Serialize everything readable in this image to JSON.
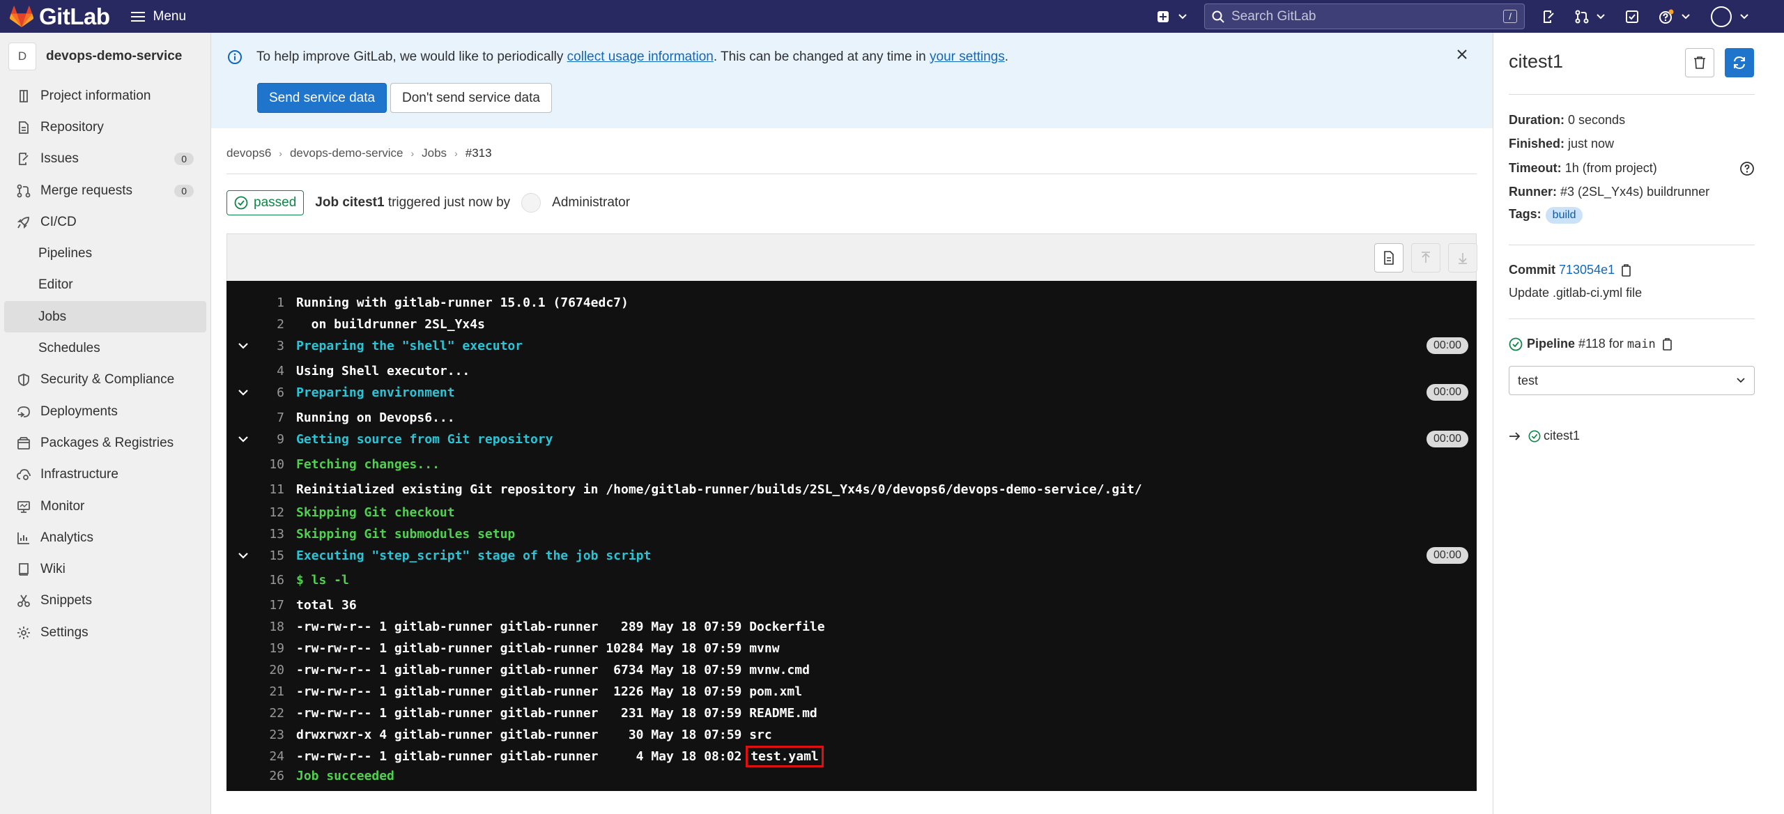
{
  "topbar": {
    "logo_text": "GitLab",
    "menu_label": "Menu",
    "search_placeholder": "Search GitLab",
    "search_shortcut": "/"
  },
  "sidebar": {
    "project_initial": "D",
    "project_name": "devops-demo-service",
    "items": [
      {
        "label": "Project information",
        "icon": "info-outline-icon"
      },
      {
        "label": "Repository",
        "icon": "doc-text-icon"
      },
      {
        "label": "Issues",
        "icon": "issues-icon",
        "count": "0"
      },
      {
        "label": "Merge requests",
        "icon": "merge-request-icon",
        "count": "0"
      },
      {
        "label": "CI/CD",
        "icon": "rocket-icon"
      },
      {
        "label": "Pipelines"
      },
      {
        "label": "Editor"
      },
      {
        "label": "Jobs"
      },
      {
        "label": "Schedules"
      },
      {
        "label": "Security & Compliance",
        "icon": "shield-icon"
      },
      {
        "label": "Deployments",
        "icon": "deployments-icon"
      },
      {
        "label": "Packages & Registries",
        "icon": "package-icon"
      },
      {
        "label": "Infrastructure",
        "icon": "cloud-gear-icon"
      },
      {
        "label": "Monitor",
        "icon": "monitor-icon"
      },
      {
        "label": "Analytics",
        "icon": "chart-icon"
      },
      {
        "label": "Wiki",
        "icon": "book-icon"
      },
      {
        "label": "Snippets",
        "icon": "snippet-icon"
      },
      {
        "label": "Settings",
        "icon": "settings-icon"
      }
    ]
  },
  "banner": {
    "text_before": "To help improve GitLab, we would like to periodically ",
    "link1": "collect usage information",
    "text_middle": ". This can be changed at any time in ",
    "link2": "your settings",
    "text_after": ".",
    "send_button": "Send service data",
    "dont_send_button": "Don't send service data"
  },
  "breadcrumb": [
    "devops6",
    "devops-demo-service",
    "Jobs",
    "#313"
  ],
  "job_header": {
    "status": "passed",
    "job_label": "Job citest1",
    "triggered_text": "triggered just now by",
    "user": "Administrator"
  },
  "log": [
    {
      "n": "1",
      "text": "Running with gitlab-runner 15.0.1 (7674edc7)",
      "style": "white"
    },
    {
      "n": "2",
      "text": "  on buildrunner 2SL_Yx4s",
      "style": "white"
    },
    {
      "n": "3",
      "text": "Preparing the \"shell\" executor",
      "style": "cyan",
      "section": true,
      "duration": "00:00"
    },
    {
      "n": "4",
      "text": "Using Shell executor...",
      "style": "white"
    },
    {
      "n": "6",
      "text": "Preparing environment",
      "style": "cyan",
      "section": true,
      "duration": "00:00"
    },
    {
      "n": "7",
      "text": "Running on Devops6...",
      "style": "white"
    },
    {
      "n": "9",
      "text": "Getting source from Git repository",
      "style": "cyan",
      "section": true,
      "duration": "00:00"
    },
    {
      "n": "10",
      "text": "Fetching changes...",
      "style": "green"
    },
    {
      "n": "11",
      "text": "Reinitialized existing Git repository in /home/gitlab-runner/builds/2SL_Yx4s/0/devops6/devops-demo-service/.git/",
      "style": "white"
    },
    {
      "n": "12",
      "text": "Skipping Git checkout",
      "style": "green"
    },
    {
      "n": "13",
      "text": "Skipping Git submodules setup",
      "style": "green"
    },
    {
      "n": "15",
      "text": "Executing \"step_script\" stage of the job script",
      "style": "cyan",
      "section": true,
      "duration": "00:00"
    },
    {
      "n": "16",
      "text": "$ ls -l",
      "style": "green"
    },
    {
      "n": "17",
      "text": "total 36",
      "style": "white"
    },
    {
      "n": "18",
      "text": "-rw-rw-r-- 1 gitlab-runner gitlab-runner   289 May 18 07:59 Dockerfile",
      "style": "white"
    },
    {
      "n": "19",
      "text": "-rw-rw-r-- 1 gitlab-runner gitlab-runner 10284 May 18 07:59 mvnw",
      "style": "white"
    },
    {
      "n": "20",
      "text": "-rw-rw-r-- 1 gitlab-runner gitlab-runner  6734 May 18 07:59 mvnw.cmd",
      "style": "white"
    },
    {
      "n": "21",
      "text": "-rw-rw-r-- 1 gitlab-runner gitlab-runner  1226 May 18 07:59 pom.xml",
      "style": "white"
    },
    {
      "n": "22",
      "text": "-rw-rw-r-- 1 gitlab-runner gitlab-runner   231 May 18 07:59 README.md",
      "style": "white"
    },
    {
      "n": "23",
      "text": "drwxrwxr-x 4 gitlab-runner gitlab-runner    30 May 18 07:59 src",
      "style": "white"
    },
    {
      "n": "24",
      "text": "-rw-rw-r-- 1 gitlab-runner gitlab-runner     4 May 18 08:02 ",
      "style": "white",
      "highlight": "test.yaml"
    },
    {
      "n": "26",
      "text": "Job succeeded",
      "style": "green"
    }
  ],
  "right_panel": {
    "title": "citest1",
    "duration_label": "Duration:",
    "duration": "0 seconds",
    "finished_label": "Finished:",
    "finished": "just now",
    "timeout_label": "Timeout:",
    "timeout": "1h (from project)",
    "runner_label": "Runner:",
    "runner": "#3 (2SL_Yx4s) buildrunner",
    "tags_label": "Tags:",
    "tag": "build",
    "commit_label": "Commit",
    "commit_sha": "713054e1",
    "commit_message": "Update .gitlab-ci.yml file",
    "pipeline_label": "Pipeline",
    "pipeline_id": "#118",
    "pipeline_for": "for",
    "pipeline_ref": "main",
    "stage_select": "test",
    "job_item": "citest1"
  },
  "colors": {
    "topbar": "#292961",
    "primary": "#1f75cb",
    "success": "#108548",
    "log_bg": "#111111"
  }
}
